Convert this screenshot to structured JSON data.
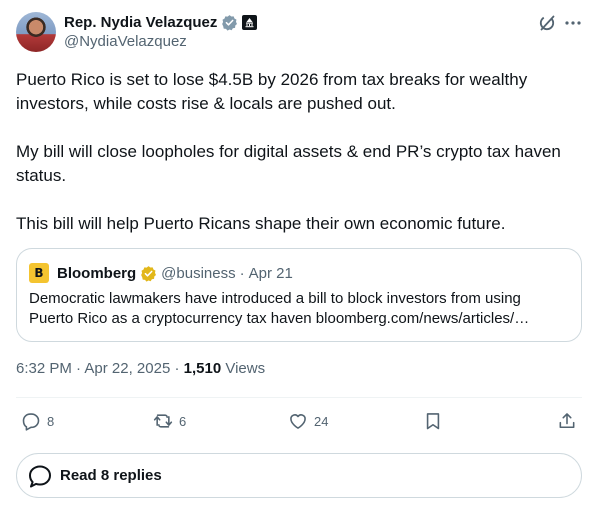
{
  "author": {
    "name": "Rep. Nydia Velazquez",
    "handle": "@NydiaVelazquez"
  },
  "tweet": {
    "paragraphs": [
      "Puerto Rico is set to lose $4.5B by 2026 from tax breaks for wealthy investors, while costs rise & locals are pushed out.",
      "My bill will close loopholes for digital assets & end PR’s crypto tax haven status.",
      "This bill will help Puerto Ricans shape their own economic future."
    ]
  },
  "quote": {
    "logo_letter": "B",
    "name": "Bloomberg",
    "handle": "@business",
    "date": "Apr 21",
    "separator": "·",
    "text": "Democratic lawmakers have introduced a bill to block investors from using Puerto Rico as a cryptocurrency tax haven  bloomberg.com/news/articles/…"
  },
  "meta": {
    "time": "6:32 PM",
    "separator": "·",
    "date": "Apr 22, 2025",
    "views_count": "1,510",
    "views_label": "Views"
  },
  "actions": {
    "replies": "8",
    "reposts": "6",
    "likes": "24"
  },
  "read_replies_label": "Read 8 replies",
  "colors": {
    "text": "#0f1419",
    "secondary": "#536471",
    "border": "#cfd9de",
    "gold_check": "#e2b719",
    "gray_badge": "#829aab"
  }
}
